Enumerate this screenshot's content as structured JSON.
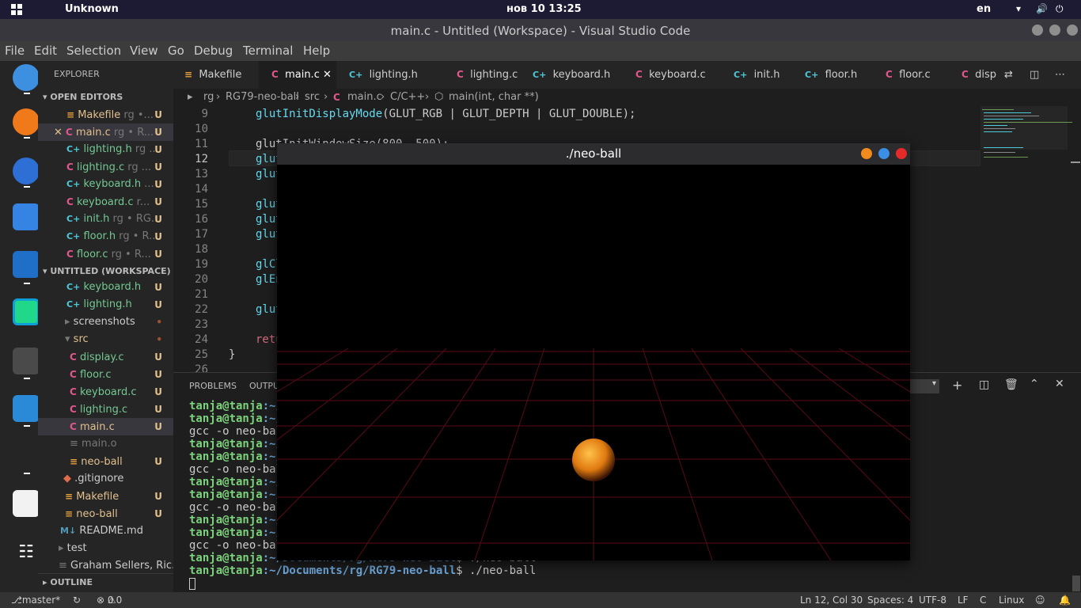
{
  "topbar": {
    "activities": "Unknown",
    "clock": "нов 10  13:25",
    "lang": "en"
  },
  "window": {
    "title": "main.c - Untitled (Workspace) - Visual Studio Code"
  },
  "menu": [
    "File",
    "Edit",
    "Selection",
    "View",
    "Go",
    "Debug",
    "Terminal",
    "Help"
  ],
  "sidebar": {
    "header": "EXPLORER",
    "open_editors_title": "OPEN EDITORS",
    "open_editors": [
      {
        "icon": "M",
        "name": "Makefile",
        "detail": "rg •...",
        "badge": "U"
      },
      {
        "icon": "C",
        "name": "main.c",
        "detail": "rg • R...",
        "badge": "U"
      },
      {
        "icon": "H",
        "name": "lighting.h",
        "detail": "rg ...",
        "badge": "U"
      },
      {
        "icon": "C",
        "name": "lighting.c",
        "detail": "rg ...",
        "badge": "U"
      },
      {
        "icon": "H",
        "name": "keyboard.h",
        "detail": "...",
        "badge": "U"
      },
      {
        "icon": "C",
        "name": "keyboard.c",
        "detail": "r...",
        "badge": "U"
      },
      {
        "icon": "H",
        "name": "init.h",
        "detail": "rg • RG...",
        "badge": "U"
      },
      {
        "icon": "H",
        "name": "floor.h",
        "detail": "rg • R...",
        "badge": "U"
      },
      {
        "icon": "C",
        "name": "floor.c",
        "detail": "rg • R...",
        "badge": "U"
      }
    ],
    "workspace_title": "UNTITLED (WORKSPACE)",
    "tree": [
      {
        "icon": "H",
        "name": "keyboard.h",
        "badge": "U"
      },
      {
        "icon": "H",
        "name": "lighting.h",
        "badge": "U"
      },
      {
        "icon": "folder",
        "name": "screenshots",
        "badge": "•"
      },
      {
        "icon": "folder-open",
        "name": "src",
        "badge": "•"
      },
      {
        "icon": "C",
        "name": "display.c",
        "badge": "U"
      },
      {
        "icon": "C",
        "name": "floor.c",
        "badge": "U"
      },
      {
        "icon": "C",
        "name": "keyboard.c",
        "badge": "U"
      },
      {
        "icon": "C",
        "name": "lighting.c",
        "badge": "U"
      },
      {
        "icon": "C",
        "name": "main.c",
        "badge": "U"
      },
      {
        "icon": "file",
        "name": "main.o",
        "badge": ""
      },
      {
        "icon": "file",
        "name": "neo-ball",
        "badge": "U"
      },
      {
        "icon": "git",
        "name": ".gitignore",
        "badge": ""
      },
      {
        "icon": "M",
        "name": "Makefile",
        "badge": "U"
      },
      {
        "icon": "file",
        "name": "neo-ball",
        "badge": "U"
      },
      {
        "icon": "md",
        "name": "README.md",
        "badge": ""
      },
      {
        "icon": "folder",
        "name": "test",
        "badge": ""
      },
      {
        "icon": "file",
        "name": "Graham Sellers, Ric...",
        "badge": ""
      }
    ],
    "outline_title": "OUTLINE"
  },
  "tabs": [
    {
      "icon": "M",
      "label": "Makefile"
    },
    {
      "icon": "C",
      "label": "main.c"
    },
    {
      "icon": "H",
      "label": "lighting.h"
    },
    {
      "icon": "C",
      "label": "lighting.c"
    },
    {
      "icon": "H",
      "label": "keyboard.h"
    },
    {
      "icon": "C",
      "label": "keyboard.c"
    },
    {
      "icon": "H",
      "label": "init.h"
    },
    {
      "icon": "H",
      "label": "floor.h"
    },
    {
      "icon": "C",
      "label": "floor.c"
    },
    {
      "icon": "C",
      "label": "disp"
    }
  ],
  "breadcrumb": {
    "a": "rg",
    "b": "RG79-neo-ball",
    "c": "src",
    "d": "main.c",
    "e": "C/C++",
    "f": "main(int, char **)"
  },
  "code": {
    "l9_fn": "glutInitDisplayMode",
    "l9_rest": "(GLUT_RGB | GLUT_DEPTH | GLUT_DOUBLE);",
    "l11": "glutInitWindowSize(800, 500);",
    "l12": "glut",
    "l13": "glut",
    "l15": "glut",
    "l16": "glut",
    "l17": "glut",
    "l19": "glCl",
    "l20": "glEn",
    "l22": "glut",
    "l24": "retu",
    "l25": "}"
  },
  "panel": {
    "problems": "PROBLEMS",
    "output": "OUTPU",
    "lines": [
      {
        "user": "tanja@tanja",
        "path": ":~/",
        "cmd": ""
      },
      {
        "user": "tanja@tanja",
        "path": ":~/",
        "cmd": ""
      },
      {
        "user": "",
        "path": "",
        "cmd": "gcc -o neo-bal"
      },
      {
        "user": "tanja@tanja",
        "path": ":~/",
        "cmd": ""
      },
      {
        "user": "tanja@tanja",
        "path": ":~/",
        "cmd": ""
      },
      {
        "user": "",
        "path": "",
        "cmd": "gcc -o neo-bal"
      },
      {
        "user": "tanja@tanja",
        "path": ":~/",
        "cmd": ""
      },
      {
        "user": "tanja@tanja",
        "path": ":~/",
        "cmd": ""
      },
      {
        "user": "",
        "path": "",
        "cmd": "gcc -o neo-bal"
      },
      {
        "user": "tanja@tanja",
        "path": ":~/",
        "cmd": ""
      },
      {
        "user": "tanja@tanja",
        "path": ":~/",
        "cmd": ""
      },
      {
        "user": "",
        "path": "",
        "cmd": "gcc -o neo-bal"
      },
      {
        "user": "tanja@tanja",
        "path": ":~/Documents/rg/RG79-neo-ball",
        "cmd": "$ ./neo-ball"
      },
      {
        "user": "tanja@tanja",
        "path": ":~/Documents/rg/RG79-neo-ball",
        "cmd": "$ ./neo-ball"
      }
    ]
  },
  "glut": {
    "title": "./neo-ball"
  },
  "status": {
    "branch": "master*",
    "errors": "0",
    "warnings": "0",
    "position": "Ln 12, Col 30",
    "spaces": "Spaces: 4",
    "encoding": "UTF-8",
    "eol": "LF",
    "lang": "C",
    "os": "Linux"
  },
  "colors": {
    "accent": "#007acc",
    "modified": "#e2c08d",
    "c_icon": "#e0578c",
    "h_icon": "#4ec9d8",
    "ball": "#f0a020"
  }
}
